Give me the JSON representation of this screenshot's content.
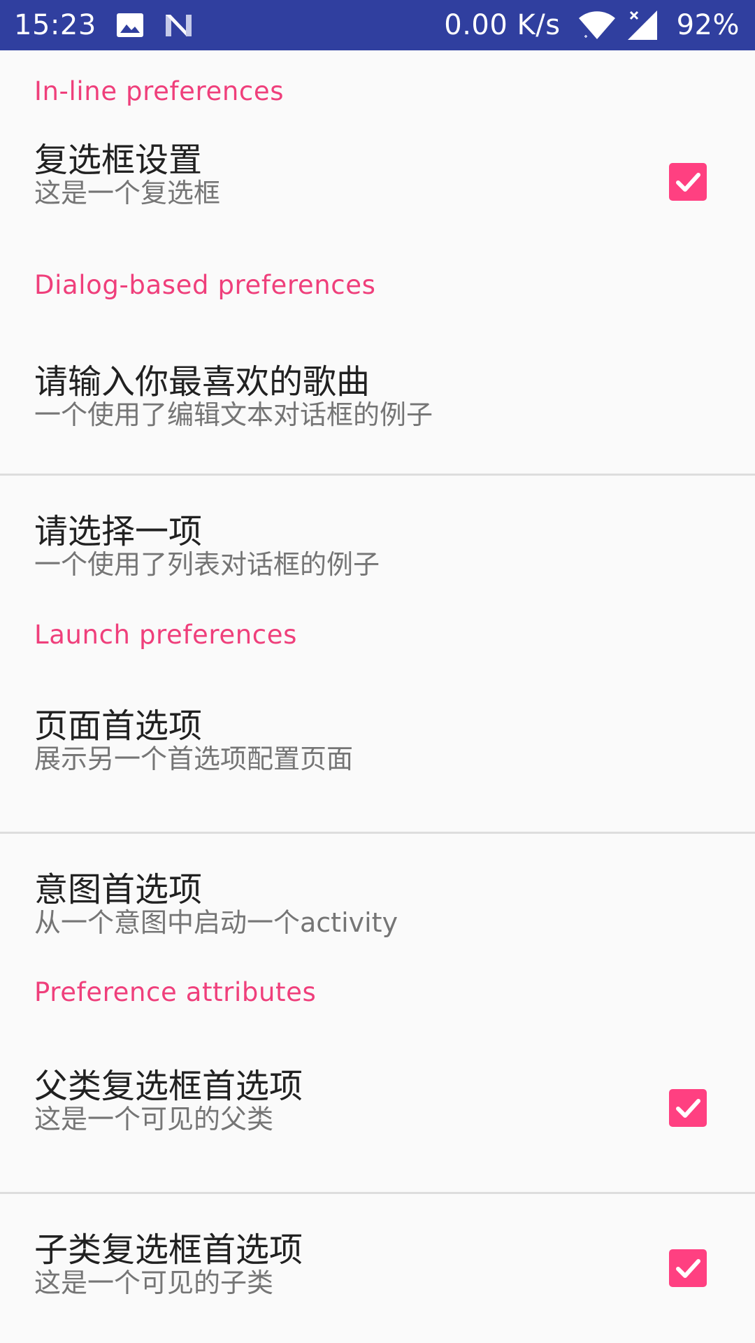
{
  "status_bar": {
    "time": "15:23",
    "speed": "0.00 K/s",
    "battery": "92%",
    "icons": [
      "image-icon",
      "n-logo-icon",
      "wifi-icon",
      "signal-icon"
    ]
  },
  "colors": {
    "status_bar": "#303f9f",
    "accent": "#ff4081",
    "category_text": "#ef3f7b"
  },
  "sections": [
    {
      "title": "In-line preferences",
      "items": [
        {
          "title": "复选框设置",
          "summary": "这是一个复选框",
          "checkbox": true,
          "checked": true
        }
      ]
    },
    {
      "title": "Dialog-based preferences",
      "items": [
        {
          "title": "请输入你最喜欢的歌曲",
          "summary": "一个使用了编辑文本对话框的例子"
        },
        {
          "title": "请选择一项",
          "summary": "一个使用了列表对话框的例子"
        }
      ]
    },
    {
      "title": "Launch preferences",
      "items": [
        {
          "title": "页面首选项",
          "summary": "展示另一个首选项配置页面"
        },
        {
          "title": "意图首选项",
          "summary": "从一个意图中启动一个activity"
        }
      ]
    },
    {
      "title": "Preference attributes",
      "items": [
        {
          "title": "父类复选框首选项",
          "summary": "这是一个可见的父类",
          "checkbox": true,
          "checked": true
        },
        {
          "title": "子类复选框首选项",
          "summary": "这是一个可见的子类",
          "checkbox": true,
          "checked": true
        }
      ]
    }
  ]
}
